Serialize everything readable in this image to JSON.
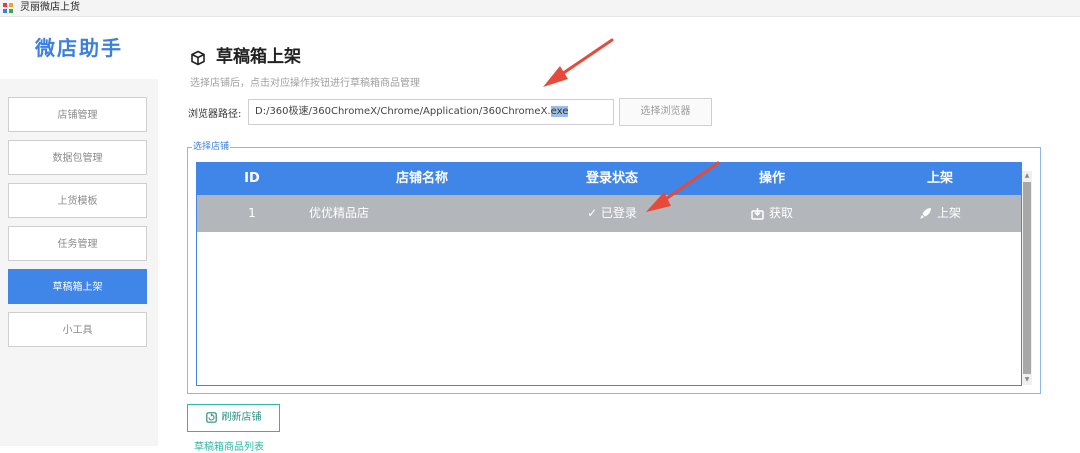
{
  "window": {
    "title": "灵丽微店上货"
  },
  "sidebar": {
    "brand": "微店助手",
    "items": [
      {
        "label": "店铺管理"
      },
      {
        "label": "数据包管理"
      },
      {
        "label": "上货模板"
      },
      {
        "label": "任务管理"
      },
      {
        "label": "草稿箱上架",
        "active": true
      },
      {
        "label": "小工具"
      }
    ]
  },
  "main": {
    "title": "草稿箱上架",
    "subtitle": "选择店铺后，点击对应操作按钮进行草稿箱商品管理",
    "browser_path": {
      "label": "浏览器路径:",
      "value_prefix": "D:/360极速/360ChromeX/Chrome/Application/360ChromeX.",
      "value_selected": "exe"
    },
    "browse_button": "选择浏览器",
    "store_group": {
      "legend": "选择店铺",
      "columns": [
        "ID",
        "店铺名称",
        "登录状态",
        "操作",
        "上架"
      ],
      "rows": [
        {
          "id": "1",
          "name": "优优精品店",
          "status": "✓ 已登录",
          "action": "获取",
          "publish": "上架"
        }
      ]
    },
    "refresh_button": "刷新店铺",
    "next_section_label": "草稿箱商品列表"
  },
  "colors": {
    "accent": "#3f86e8",
    "row_selected": "#b3b6bb",
    "teal": "#2fb7a4",
    "annotation": "#e64a3b"
  }
}
